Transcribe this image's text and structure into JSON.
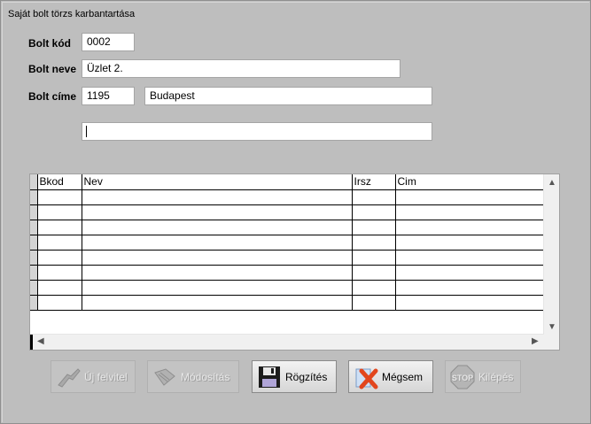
{
  "window": {
    "title": "Saját bolt törzs karbantartása"
  },
  "form": {
    "kod_label": "Bolt kód",
    "kod_value": "0002",
    "nev_label": "Bolt neve",
    "nev_value": "Üzlet 2.",
    "cim_label": "Bolt címe",
    "irsz_value": "1195",
    "varos_value": "Budapest",
    "cim2_value": ""
  },
  "grid": {
    "columns": [
      "Bkod",
      "Nev",
      "Irsz",
      "Cim"
    ],
    "row_count": 8
  },
  "buttons": {
    "uj": {
      "label": "Új felvitel",
      "icon": "new-record-icon",
      "enabled": false
    },
    "modositas": {
      "label": "Módosítás",
      "icon": "edit-icon",
      "enabled": false
    },
    "rogzites": {
      "label": "Rögzítés",
      "icon": "floppy-disk-icon",
      "enabled": true
    },
    "megsem": {
      "label": "Mégsem",
      "icon": "cancel-x-icon",
      "enabled": true
    },
    "kilepes": {
      "label": "Kilépés",
      "icon": "stop-sign-icon",
      "enabled": false
    }
  }
}
